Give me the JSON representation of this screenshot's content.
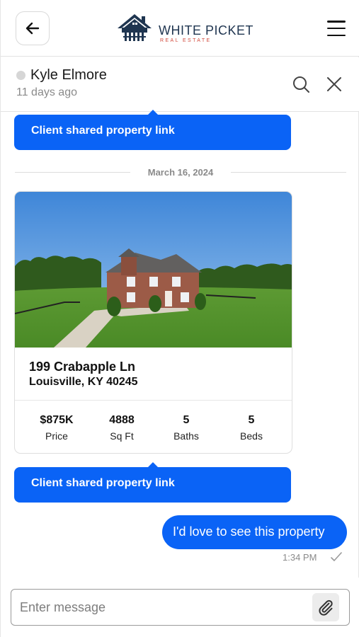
{
  "header": {
    "brand_name": "WHITE PICKET",
    "brand_sub": "REAL ESTATE"
  },
  "conversation": {
    "contact_name": "Kyle Elmore",
    "last_seen": "11 days ago"
  },
  "messages": {
    "shared_link_label_1": "Client shared property link",
    "date_separator": "March 16, 2024",
    "property": {
      "address_line1": "199 Crabapple Ln",
      "address_line2": "Louisville, KY 40245",
      "stats": [
        {
          "value": "$875K",
          "label": "Price"
        },
        {
          "value": "4888",
          "label": "Sq Ft"
        },
        {
          "value": "5",
          "label": "Baths"
        },
        {
          "value": "5",
          "label": "Beds"
        }
      ]
    },
    "shared_link_label_2": "Client shared property link",
    "outgoing_text": "I'd love to see this property",
    "outgoing_time": "1:34 PM"
  },
  "composer": {
    "placeholder": "Enter message"
  },
  "colors": {
    "accent": "#0a63f6",
    "brand_navy": "#1f3550",
    "brand_red": "#d24a3c"
  },
  "icons": {
    "back": "arrow-left-icon",
    "menu": "hamburger-menu-icon",
    "search": "search-icon",
    "close": "close-icon",
    "read": "checkmark-icon",
    "attach": "paperclip-icon"
  }
}
